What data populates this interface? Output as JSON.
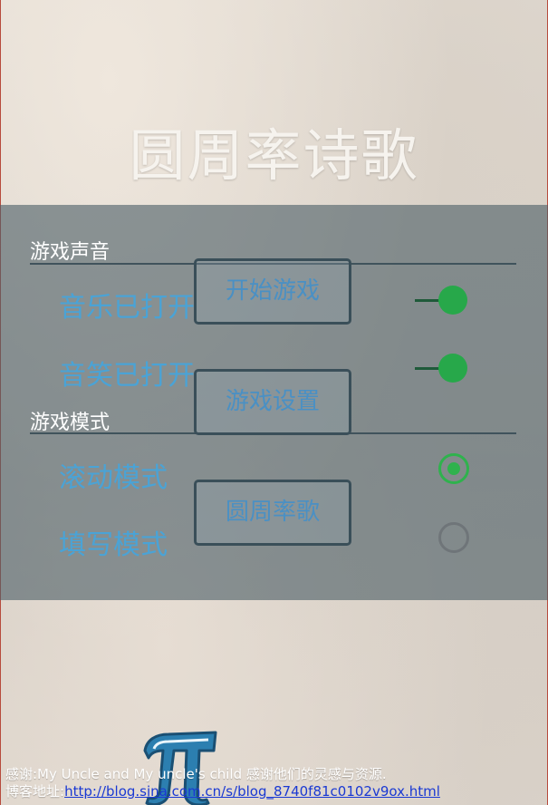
{
  "app": {
    "title": "圆周率诗歌"
  },
  "settings": {
    "sound_section": {
      "header": "游戏声音",
      "items": [
        {
          "label": "音乐已打开",
          "state": "on"
        },
        {
          "label": "音笑已打开",
          "state": "on"
        }
      ]
    },
    "mode_section": {
      "header": "游戏模式",
      "items": [
        {
          "label": "滚动模式",
          "selected": true
        },
        {
          "label": "填写模式",
          "selected": false
        }
      ]
    }
  },
  "menu": {
    "start_label": "开始游戏",
    "settings_label": "游戏设置",
    "pi_song_label": "圆周率歌"
  },
  "logo": {
    "icon": "pi-logo-icon"
  },
  "credits": {
    "line1": "感谢:My Uncle and My uncle's child 感谢他们的灵感与资源.",
    "blog_label": "博客地址:",
    "blog_url": "http://blog.sina.com.cn/s/blog_8740f81c0102v9ox.html"
  },
  "colors": {
    "accent_blue": "#4aa3d6",
    "toggle_green": "#27a84a",
    "panel": "#4e5f68"
  }
}
